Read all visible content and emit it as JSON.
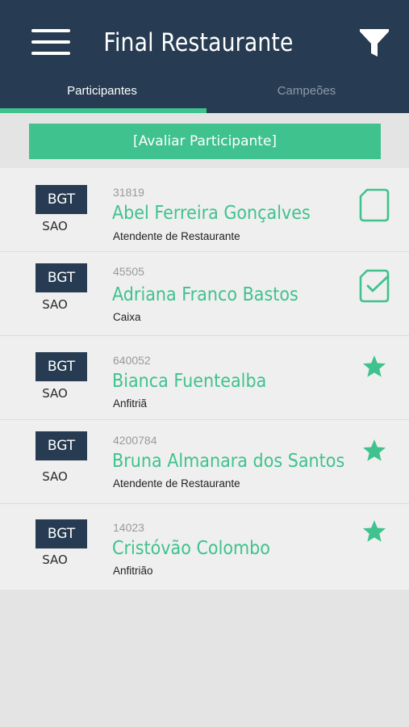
{
  "header": {
    "title": "Final Restaurante",
    "menu_icon": "hamburger-menu-icon",
    "filter_icon": "filter-funnel-icon"
  },
  "tabs": [
    {
      "label": "Participantes",
      "active": true
    },
    {
      "label": "Campeões",
      "active": false
    }
  ],
  "actions": {
    "evaluate_label": "[Avaliar Participante]"
  },
  "colors": {
    "header_bg": "#273c52",
    "accent": "#3fc28e",
    "badge_bg": "#273c52"
  },
  "participants": [
    {
      "company": "BGT",
      "airport": "SAO",
      "id": "31819",
      "name": "Abel Ferreira Gonçalves",
      "role": "Atendente de Restaurante",
      "status": "pending",
      "status_icon": "blank-clipboard-icon"
    },
    {
      "company": "BGT",
      "airport": "SAO",
      "id": "45505",
      "name": "Adriana Franco Bastos",
      "role": "Caixa",
      "status": "evaluated",
      "status_icon": "checked-clipboard-icon"
    },
    {
      "company": "BGT",
      "airport": "SAO",
      "id": "640052",
      "name": "Bianca Fuentealba",
      "role": "Anfitriã",
      "status": "champion",
      "status_icon": "star-icon"
    },
    {
      "company": "BGT",
      "airport": "SAO",
      "id": "4200784",
      "name": "Bruna Almanara dos Santos",
      "role": "Atendente de Restaurante",
      "status": "champion",
      "status_icon": "star-icon"
    },
    {
      "company": "BGT",
      "airport": "SAO",
      "id": "14023",
      "name": "Cristóvão Colombo",
      "role": "Anfitrião",
      "status": "champion",
      "status_icon": "star-icon"
    }
  ]
}
